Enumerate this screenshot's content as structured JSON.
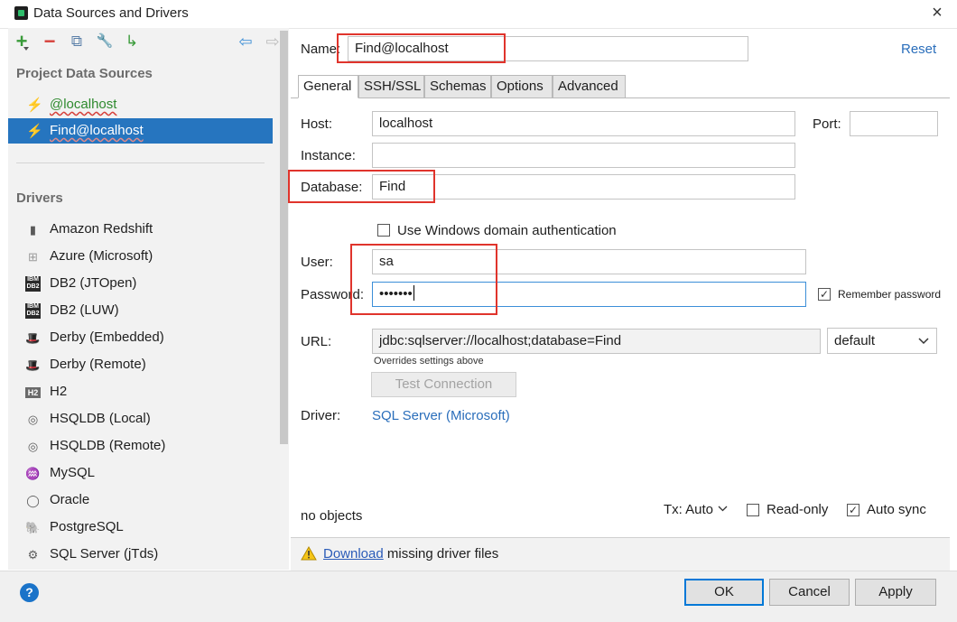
{
  "window": {
    "title": "Data Sources and Drivers",
    "close": "×"
  },
  "left": {
    "toolbar": {
      "add": "+",
      "remove": "−",
      "copy": "⧉",
      "settings": "🔧",
      "import": "↳",
      "back": "⇦",
      "forward": "⇨"
    },
    "project_header": "Project Data Sources",
    "data_sources": [
      {
        "label": "@localhost",
        "icon": "plug-icon"
      },
      {
        "label": "Find@localhost",
        "icon": "plug-icon"
      }
    ],
    "drivers_header": "Drivers",
    "drivers": [
      {
        "label": "Amazon Redshift",
        "glyph": "▮"
      },
      {
        "label": "Azure (Microsoft)",
        "glyph": "⊞"
      },
      {
        "label": "DB2 (JTOpen)",
        "glyph": "IBM DB2"
      },
      {
        "label": "DB2 (LUW)",
        "glyph": "IBM DB2"
      },
      {
        "label": "Derby (Embedded)",
        "glyph": "🎩"
      },
      {
        "label": "Derby (Remote)",
        "glyph": "🎩"
      },
      {
        "label": "H2",
        "glyph": "H2"
      },
      {
        "label": "HSQLDB (Local)",
        "glyph": "◎"
      },
      {
        "label": "HSQLDB (Remote)",
        "glyph": "◎"
      },
      {
        "label": "MySQL",
        "glyph": "♒"
      },
      {
        "label": "Oracle",
        "glyph": "◯"
      },
      {
        "label": "PostgreSQL",
        "glyph": "🐘"
      },
      {
        "label": "SQL Server (jTds)",
        "glyph": "⚙"
      }
    ]
  },
  "form": {
    "name_label": "Name:",
    "name_value": "Find@localhost",
    "reset": "Reset",
    "tabs": [
      "General",
      "SSH/SSL",
      "Schemas",
      "Options",
      "Advanced"
    ],
    "host_label": "Host:",
    "host_value": "localhost",
    "port_label": "Port:",
    "port_value": "",
    "instance_label": "Instance:",
    "instance_value": "",
    "database_label": "Database:",
    "database_value": "Find",
    "windows_auth_label": "Use Windows domain authentication",
    "user_label": "User:",
    "user_value": "sa",
    "password_label": "Password:",
    "password_value": "•••••••",
    "remember_password": "Remember password",
    "url_label": "URL:",
    "url_value": "jdbc:sqlserver://localhost;database=Find",
    "url_mode": "default",
    "url_hint": "Overrides settings above",
    "test_connection": "Test Connection",
    "driver_label": "Driver:",
    "driver_value": "SQL Server (Microsoft)",
    "no_objects": "no objects",
    "tx_label": "Tx: Auto",
    "read_only": "Read-only",
    "auto_sync": "Auto sync",
    "warning_link": "Download",
    "warning_text": " missing driver files"
  },
  "footer": {
    "help": "?",
    "ok": "OK",
    "cancel": "Cancel",
    "apply": "Apply"
  },
  "colors": {
    "accent": "#2675bf",
    "link": "#2a6ebb",
    "highlight_box": "#e0342c"
  }
}
